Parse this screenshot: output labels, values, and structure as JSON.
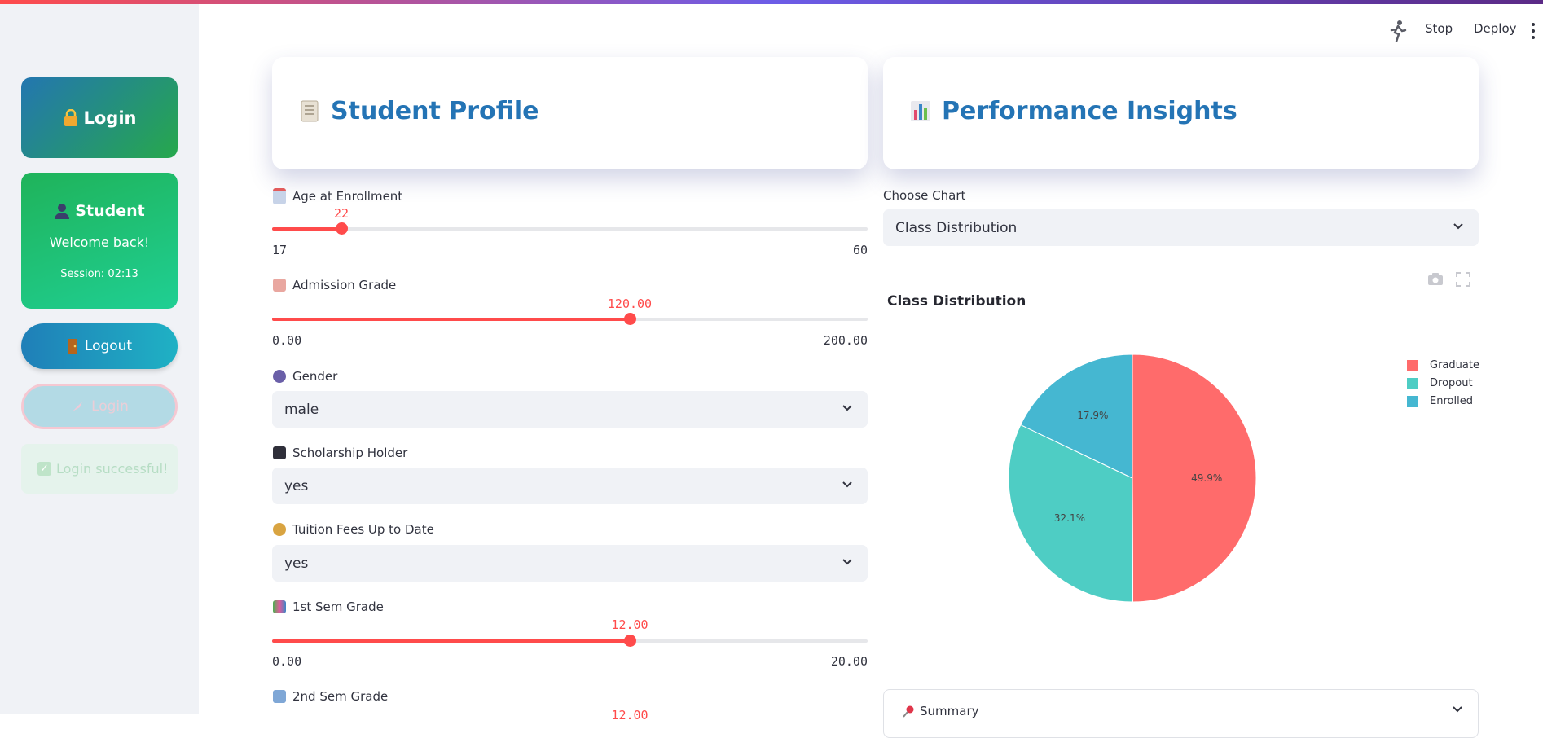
{
  "sidebar": {
    "login_card": {
      "icon": "lock-icon",
      "label": "Login"
    },
    "student_card": {
      "icon": "user-icon",
      "title": "Student",
      "welcome": "Welcome back!",
      "session": "Session: 02:13"
    },
    "logout_button": {
      "icon": "door-icon",
      "label": "Logout"
    },
    "login_button": {
      "icon": "rocket-icon",
      "label": "Login"
    },
    "success_message": {
      "icon": "check-icon",
      "text": "Login successful!"
    }
  },
  "toolbar": {
    "stop_label": "Stop",
    "deploy_label": "Deploy",
    "menu_icon": "kebab-menu-icon"
  },
  "student_profile": {
    "title": "Student Profile",
    "icon": "scroll-icon",
    "age": {
      "label": "Age at Enrollment",
      "icon": "calendar-icon",
      "value": "22",
      "min": "17",
      "max": "60",
      "fraction": 0.116
    },
    "admission_grade": {
      "label": "Admission Grade",
      "icon": "memo-icon",
      "value": "120.00",
      "min": "0.00",
      "max": "200.00",
      "fraction": 0.6
    },
    "gender": {
      "label": "Gender",
      "icon": "people-icon",
      "selected": "male"
    },
    "scholarship": {
      "label": "Scholarship Holder",
      "icon": "graduation-cap-icon",
      "selected": "yes"
    },
    "tuition": {
      "label": "Tuition Fees Up to Date",
      "icon": "money-bag-icon",
      "selected": "yes"
    },
    "sem1": {
      "label": "1st Sem Grade",
      "icon": "books-icon",
      "value": "12.00",
      "min": "0.00",
      "max": "20.00",
      "fraction": 0.6
    },
    "sem2": {
      "label": "2nd Sem Grade",
      "icon": "open-book-icon",
      "value": "12.00"
    }
  },
  "performance": {
    "title": "Performance Insights",
    "icon": "bar-chart-icon",
    "choose_label": "Choose Chart",
    "selected_chart": "Class Distribution",
    "summary_label": "Summary",
    "summary_icon": "pushpin-icon"
  },
  "chart_data": {
    "type": "pie",
    "title": "Class Distribution",
    "labels": [
      "Graduate",
      "Dropout",
      "Enrolled"
    ],
    "values": [
      49.9,
      32.1,
      17.9
    ],
    "value_labels": [
      "49.9%",
      "32.1%",
      "17.9%"
    ],
    "colors": [
      "#ff6b6b",
      "#4ecdc4",
      "#45b7d1"
    ],
    "legend_position": "top-right"
  }
}
